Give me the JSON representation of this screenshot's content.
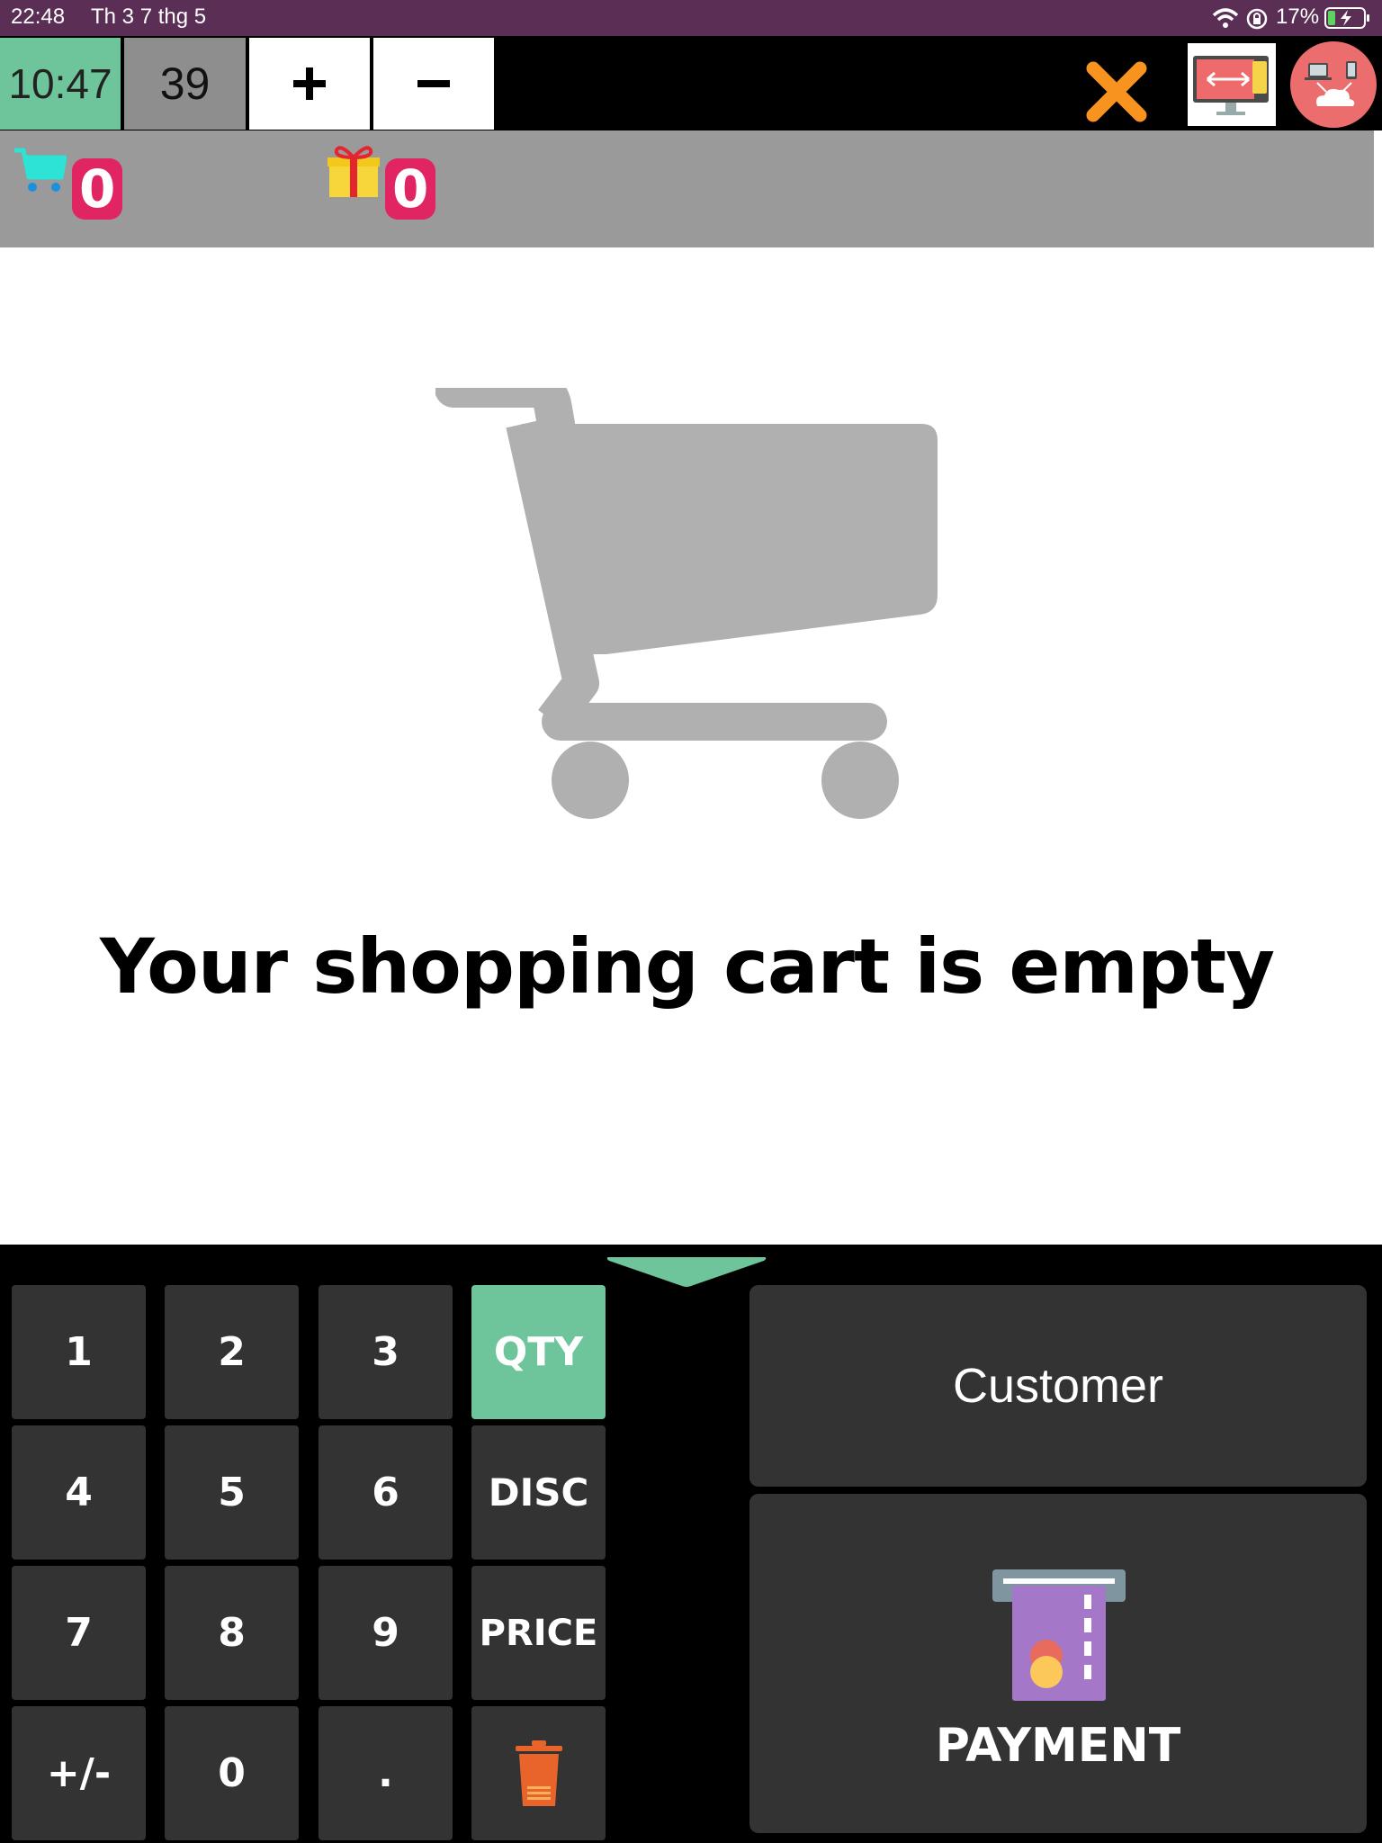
{
  "status_bar": {
    "time": "22:48",
    "date": "Th 3 7 thg 5",
    "battery_percent": "17%",
    "icons": [
      "wifi-icon",
      "rotation-lock-icon",
      "battery-charging-icon"
    ]
  },
  "toolbar": {
    "clock": "10:47",
    "number": "39",
    "plus_icon": "plus-icon",
    "minus_icon": "minus-icon",
    "close_icon": "close-icon",
    "sync_icon": "screen-sync-icon",
    "cloud_icon": "cloud-devices-icon",
    "colors": {
      "clock_bg": "#6ec59b",
      "close": "#f7931e",
      "cloud_bg": "#ec6d6d"
    }
  },
  "counters": {
    "cart_count": "0",
    "gift_count": "0",
    "badge_color": "#e02562"
  },
  "cart": {
    "empty_message": "Your shopping cart is empty"
  },
  "keypad": {
    "keys": [
      "1",
      "2",
      "3",
      "QTY",
      "4",
      "5",
      "6",
      "DISC",
      "7",
      "8",
      "9",
      "PRICE",
      "+/-",
      "0",
      ".",
      ""
    ],
    "active_mode": "QTY",
    "delete_icon": "trash-icon"
  },
  "actions": {
    "customer_label": "Customer",
    "payment_label": "PAYMENT",
    "payment_icon": "card-terminal-icon"
  }
}
